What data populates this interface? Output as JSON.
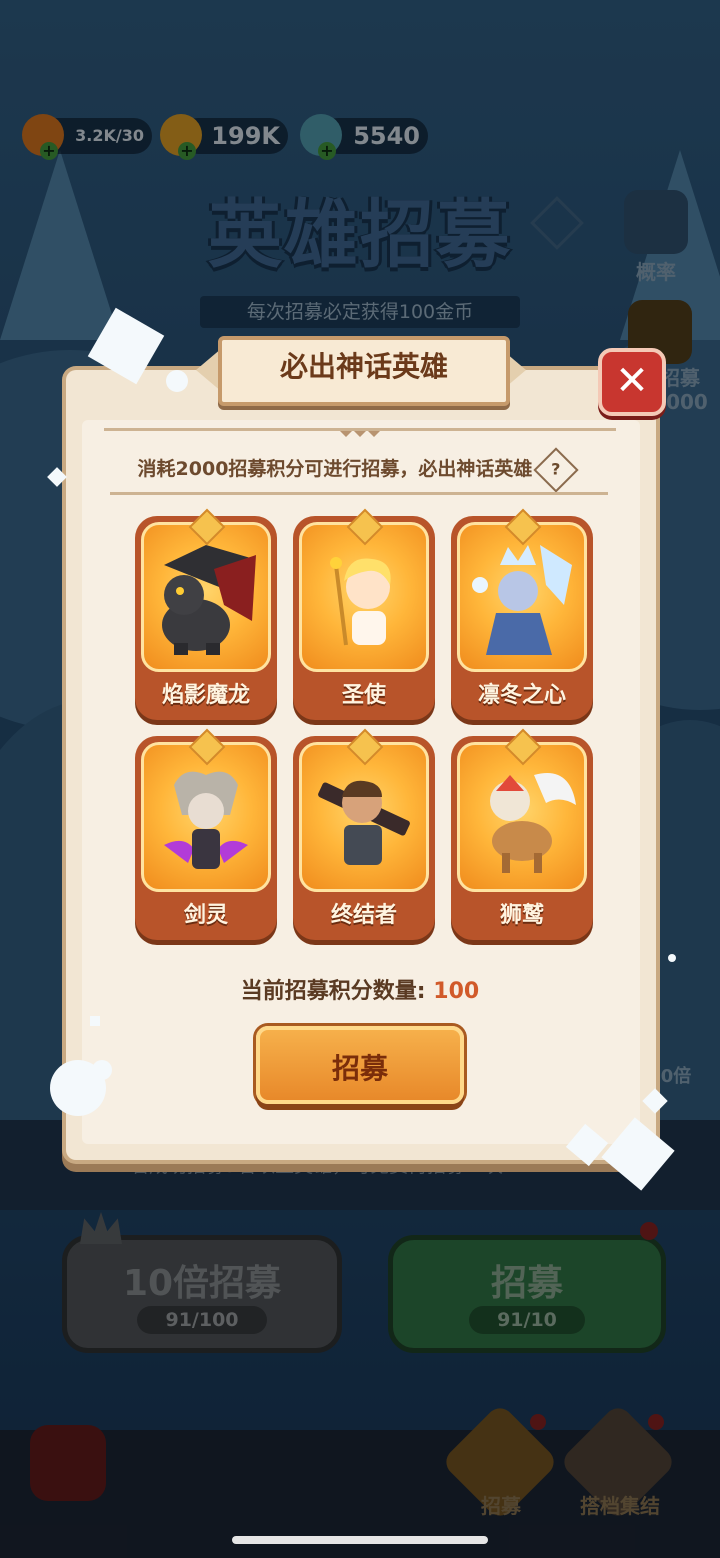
{
  "resources": {
    "energy": "3.2K/30",
    "gold": "199K",
    "gems": "5540"
  },
  "background": {
    "title": "英雄招募",
    "subtitle": "每次招募必定获得100金币",
    "subtitle_highlight": "100",
    "side_buttons": [
      {
        "label": "概率"
      },
      {
        "label": "招募",
        "sub": "2000"
      }
    ],
    "right_partial_text": "0倍",
    "note": "若成功招募5名以上英雄，可免费再招募一次",
    "ten_recruit": {
      "label": "10倍招募",
      "count": "91/100"
    },
    "single_recruit": {
      "label": "招募",
      "count": "91/10"
    },
    "nav": [
      {
        "label": "招募"
      },
      {
        "label": "搭档集结"
      }
    ]
  },
  "modal": {
    "title": "必出神话英雄",
    "description": "消耗2000招募积分可进行招募，必出神话英雄",
    "heroes": [
      {
        "name": "焰影魔龙"
      },
      {
        "name": "圣使"
      },
      {
        "name": "凛冬之心"
      },
      {
        "name": "剑灵"
      },
      {
        "name": "终结者"
      },
      {
        "name": "狮鹫"
      }
    ],
    "score_label": "当前招募积分数量: ",
    "score_value": "100",
    "recruit_button": "招募"
  },
  "colors": {
    "panel": "#f2e6d3",
    "card_orange": "#f08c1d",
    "close_red": "#c8362f",
    "score_value": "#d15a2a"
  }
}
